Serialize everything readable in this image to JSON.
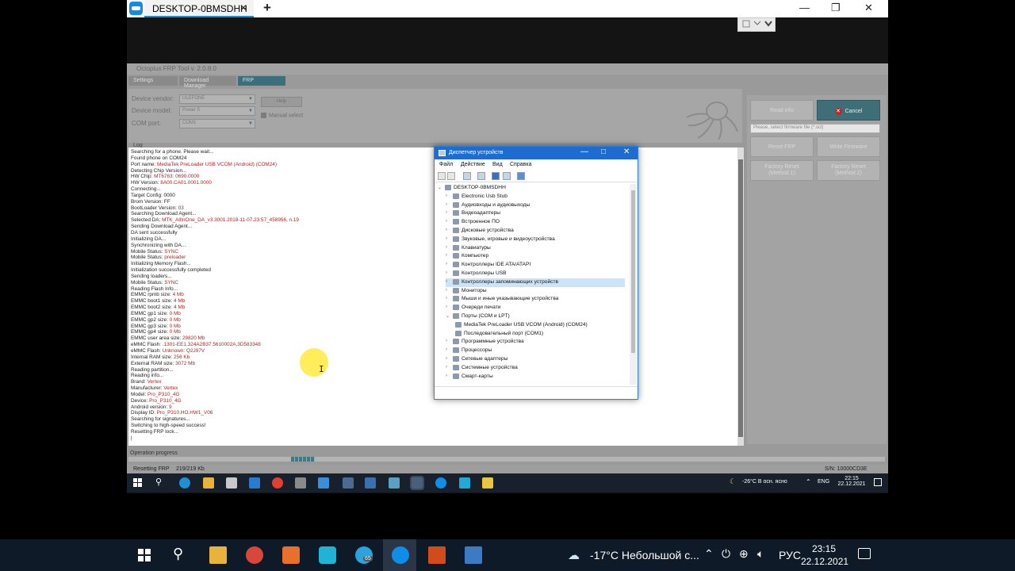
{
  "teamviewer": {
    "tab_title": "DESKTOP-0BMSDHH",
    "tab_close": "✕",
    "new_tab": "+",
    "minimize": "—",
    "maximize": "❐",
    "close": "✕"
  },
  "octoplus": {
    "title": "Octoplus FRP Tool v. 2.0.8.0",
    "tabs": [
      "Settings",
      "Download Manager",
      "FRP"
    ],
    "vendor_label": "Device vendor:",
    "vendor_value": "ULEFONE",
    "model_label": "Device model:",
    "model_value": "Power 5",
    "port_label": "COM port:",
    "port_value": "COM1",
    "help_label": "Help",
    "manual_select": "Manual select",
    "log_label": "Log",
    "log_lines": [
      [
        "Searching for a phone. Please wait...",
        ""
      ],
      [
        "Found phone on COM24",
        ""
      ],
      [
        "Port name: ",
        "MediaTek PreLoader USB VCOM (Android) (COM24)"
      ],
      [
        "Detecting Chip Version...",
        ""
      ],
      [
        "HW Chip: ",
        "MT6763: 0690.0000"
      ],
      [
        "HW Version: ",
        "8A00.CA01.0001.0000"
      ],
      [
        "Connecting...",
        ""
      ],
      [
        "Target Config: 0000",
        ""
      ],
      [
        "Brom Version: FF",
        ""
      ],
      [
        "BootLoader Version: ",
        "03"
      ],
      [
        "Searching Download Agent...",
        ""
      ],
      [
        "Selected DA: ",
        "MTK_AllInOne_DA_v3.3001.2018-11-07.23:57_458956, n.19"
      ],
      [
        "Sending Download Agent...",
        ""
      ],
      [
        "DA sent successfully",
        ""
      ],
      [
        "Initializing DA...",
        ""
      ],
      [
        "Synchronizing with DA...",
        ""
      ],
      [
        "Mobile Status: ",
        "SYNC"
      ],
      [
        "Mobile Status: ",
        "preloader"
      ],
      [
        "Initializing Memory Flash...",
        ""
      ],
      [
        "Initialization successfully completed",
        ""
      ],
      [
        "Sending loaders...",
        ""
      ],
      [
        "Mobile Status: ",
        "SYNC"
      ],
      [
        "Reading Flash Info...",
        ""
      ],
      [
        "EMMC rpmb size: ",
        "4 Mb"
      ],
      [
        "EMMC boot1 size: ",
        "4 Mb"
      ],
      [
        "EMMC boot2 size: ",
        "4 Mb"
      ],
      [
        "EMMC gp1 size: ",
        "0 Mb"
      ],
      [
        "EMMC gp2 size: ",
        "0 Mb"
      ],
      [
        "EMMC gp3 size: ",
        "0 Mb"
      ],
      [
        "EMMC gp4 size: ",
        "0 Mb"
      ],
      [
        "EMMC user area size: ",
        "29820 Mb"
      ],
      [
        "eMMC Flash: ",
        ".1301-EE1.324A2B37.5610002A.3D583348"
      ],
      [
        "eMMC Flash: ",
        "Unknown: Q2J97V"
      ],
      [
        "Internal RAM size: ",
        "256 Kb"
      ],
      [
        "External RAM size: ",
        "3072 Mb"
      ],
      [
        "Reading partition...",
        ""
      ],
      [
        "Reading info...",
        ""
      ],
      [
        "Brand: ",
        "Vertex"
      ],
      [
        "Manufacturer: ",
        "Vertex"
      ],
      [
        "Model: ",
        "Pro_P310_4G"
      ],
      [
        "Device: ",
        "Pro_P310_4G"
      ],
      [
        "Android version: ",
        "9"
      ],
      [
        "Display ID: ",
        "Pro_P310.HO.HW1_V06"
      ],
      [
        "Searching for signatures...",
        ""
      ],
      [
        "Switching to high-speed success!",
        ""
      ],
      [
        "Resetting FRP lock...",
        ""
      ],
      [
        "|",
        ""
      ]
    ],
    "read_info": "Read info",
    "cancel": "Cancel",
    "firmware_placeholder": "Please, select firmware file (*.scl)",
    "reset_frp": "Reset FRP",
    "write_firmware": "Write Firmware",
    "factory_reset_1_a": "Factory Reset",
    "factory_reset_1_b": "(Method 1)",
    "factory_reset_2_a": "Factory Reset",
    "factory_reset_2_b": "(Method 2)",
    "operation_progress": "Operation progress",
    "status_action": "Resetting FRP",
    "status_progress": "219/219 Kb",
    "status_sn": "S/N: 10000CD3E"
  },
  "device_manager": {
    "title": "Диспетчер устройств",
    "menu": [
      "Файл",
      "Действие",
      "Вид",
      "Справка"
    ],
    "root": "DESKTOP-0BMSDHH",
    "items": [
      {
        "label": "Electronic Usb Stub",
        "expanded": false
      },
      {
        "label": "Аудиовходы и аудиовыходы",
        "expanded": false
      },
      {
        "label": "Видеоадаптеры",
        "expanded": false
      },
      {
        "label": "Встроенное ПО",
        "expanded": false
      },
      {
        "label": "Дисковые устройства",
        "expanded": false
      },
      {
        "label": "Звуковые, игровые и видеоустройства",
        "expanded": false
      },
      {
        "label": "Клавиатуры",
        "expanded": false
      },
      {
        "label": "Компьютер",
        "expanded": false
      },
      {
        "label": "Контроллеры IDE ATA/ATAPI",
        "expanded": false
      },
      {
        "label": "Контроллеры USB",
        "expanded": false
      },
      {
        "label": "Контроллеры запоминающих устройств",
        "expanded": false,
        "selected": true
      },
      {
        "label": "Мониторы",
        "expanded": false
      },
      {
        "label": "Мыши и иные указывающие устройства",
        "expanded": false
      },
      {
        "label": "Очереди печати",
        "expanded": false
      },
      {
        "label": "Порты (COM и LPT)",
        "expanded": true
      }
    ],
    "ports_children": [
      "MediaTek PreLoader USB VCOM (Android) (COM24)",
      "Последовательный порт (COM1)"
    ],
    "items_after": [
      "Программные устройства",
      "Процессоры",
      "Сетевые адаптеры",
      "Системные устройства",
      "Смарт-карты"
    ]
  },
  "remote_taskbar": {
    "weather": "-26°C  В осн. ясно",
    "lang": "ENG",
    "time": "22:15",
    "date": "22.12.2021"
  },
  "taskbar": {
    "weather": "-17°C  Небольшой с...",
    "lang": "РУС",
    "time": "23:15",
    "date": "22.12.2021",
    "badge": "65"
  }
}
